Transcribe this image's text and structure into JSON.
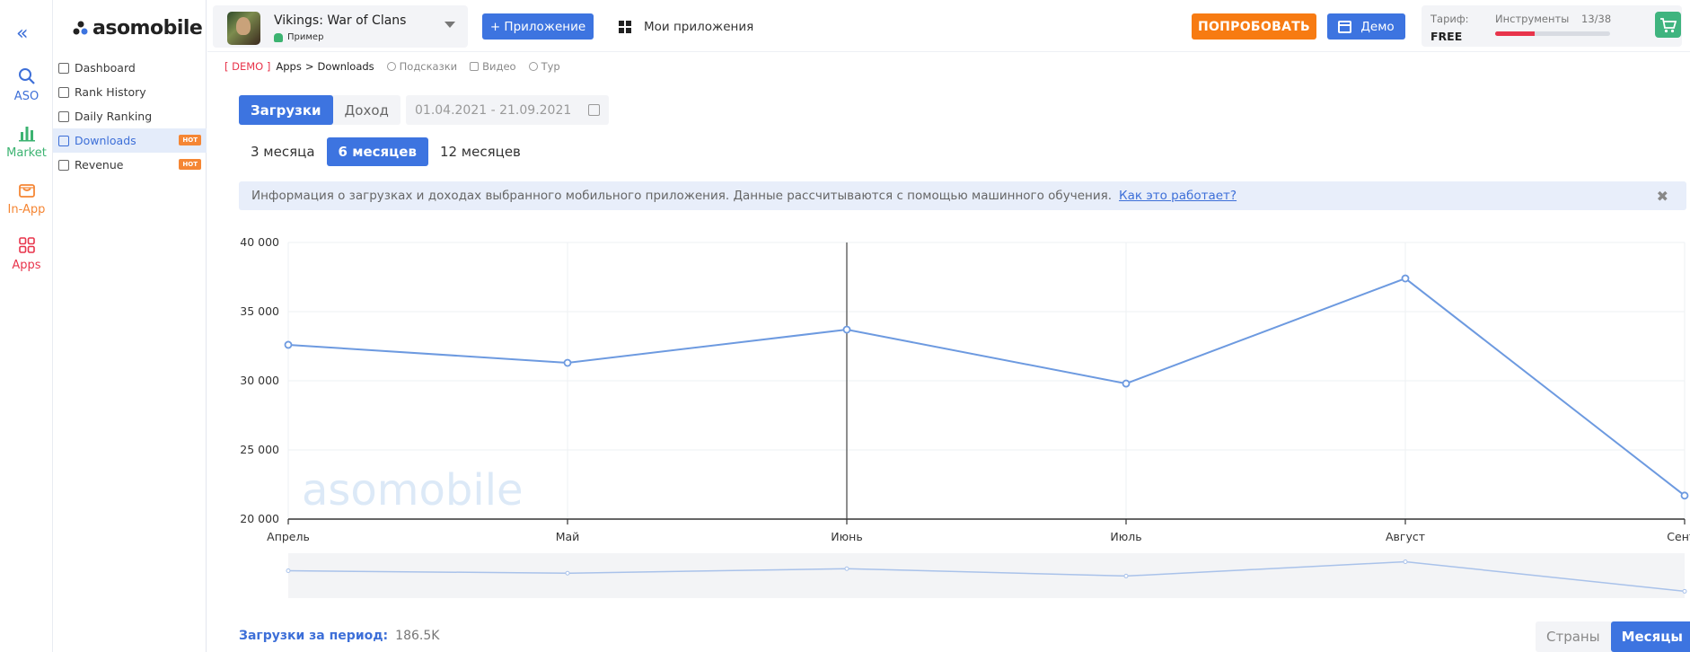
{
  "rail": {
    "items": [
      {
        "label": "ASO",
        "color": "#3d6fd8",
        "icon": "search-icon"
      },
      {
        "label": "Market",
        "color": "#3cb371",
        "icon": "bar-chart-icon"
      },
      {
        "label": "In-App",
        "color": "#f58634",
        "icon": "bag-icon"
      },
      {
        "label": "Apps",
        "color": "#e8344b",
        "icon": "apps-grid-icon"
      }
    ]
  },
  "logo": {
    "text": "asomobile"
  },
  "nav": {
    "items": [
      {
        "label": "Dashboard"
      },
      {
        "label": "Rank History"
      },
      {
        "label": "Daily Ranking"
      },
      {
        "label": "Downloads",
        "badge": "HOT"
      },
      {
        "label": "Revenue",
        "badge": "HOT"
      }
    ]
  },
  "topbar": {
    "app_name": "Vikings: War of Clans",
    "app_sub": "Пример",
    "add_app": "+ Приложение",
    "my_apps": "Мои приложения",
    "try": "ПОПРОБОВАТЬ",
    "demo": "Демо",
    "tariff_label": "Тариф:",
    "tariff_value": "FREE",
    "tools_label": "Инструменты",
    "tools_count": "13/38",
    "tools_used_fraction": 0.34
  },
  "breadcrumb": {
    "demo": "[ DEMO ]",
    "apps": "Apps",
    "sep": ">",
    "current": "Downloads",
    "hints": "Подсказки",
    "video": "Видео",
    "tour": "Тур"
  },
  "metric_toggle": {
    "downloads": "Загрузки",
    "revenue": "Доход"
  },
  "date_range": "01.04.2021 - 21.09.2021",
  "period_toggle": {
    "p3": "3 месяца",
    "p6": "6 месяцев",
    "p12": "12 месяцев"
  },
  "info": {
    "text": "Информация о загрузках и доходах выбранного мобильного приложения. Данные рассчитываются с помощью машинного обучения.",
    "link": "Как это работает?",
    "close": "✖"
  },
  "chart_data": {
    "type": "line",
    "categories": [
      "Апрель",
      "Май",
      "Июнь",
      "Июль",
      "Август",
      "Сентя"
    ],
    "values": [
      32600,
      31300,
      33700,
      29800,
      37400,
      21700
    ],
    "y_ticks": [
      "40 000",
      "35 000",
      "30 000",
      "25 000",
      "20 000"
    ],
    "ylim": [
      20000,
      40000
    ],
    "watermark": "asomobile",
    "highlight_category": "Июнь",
    "line_color": "#6d9ae0",
    "grid": true
  },
  "footer": {
    "total_label": "Загрузки за период:",
    "total_value": "186.5K",
    "by_countries": "Страны",
    "by_months": "Месяцы"
  }
}
